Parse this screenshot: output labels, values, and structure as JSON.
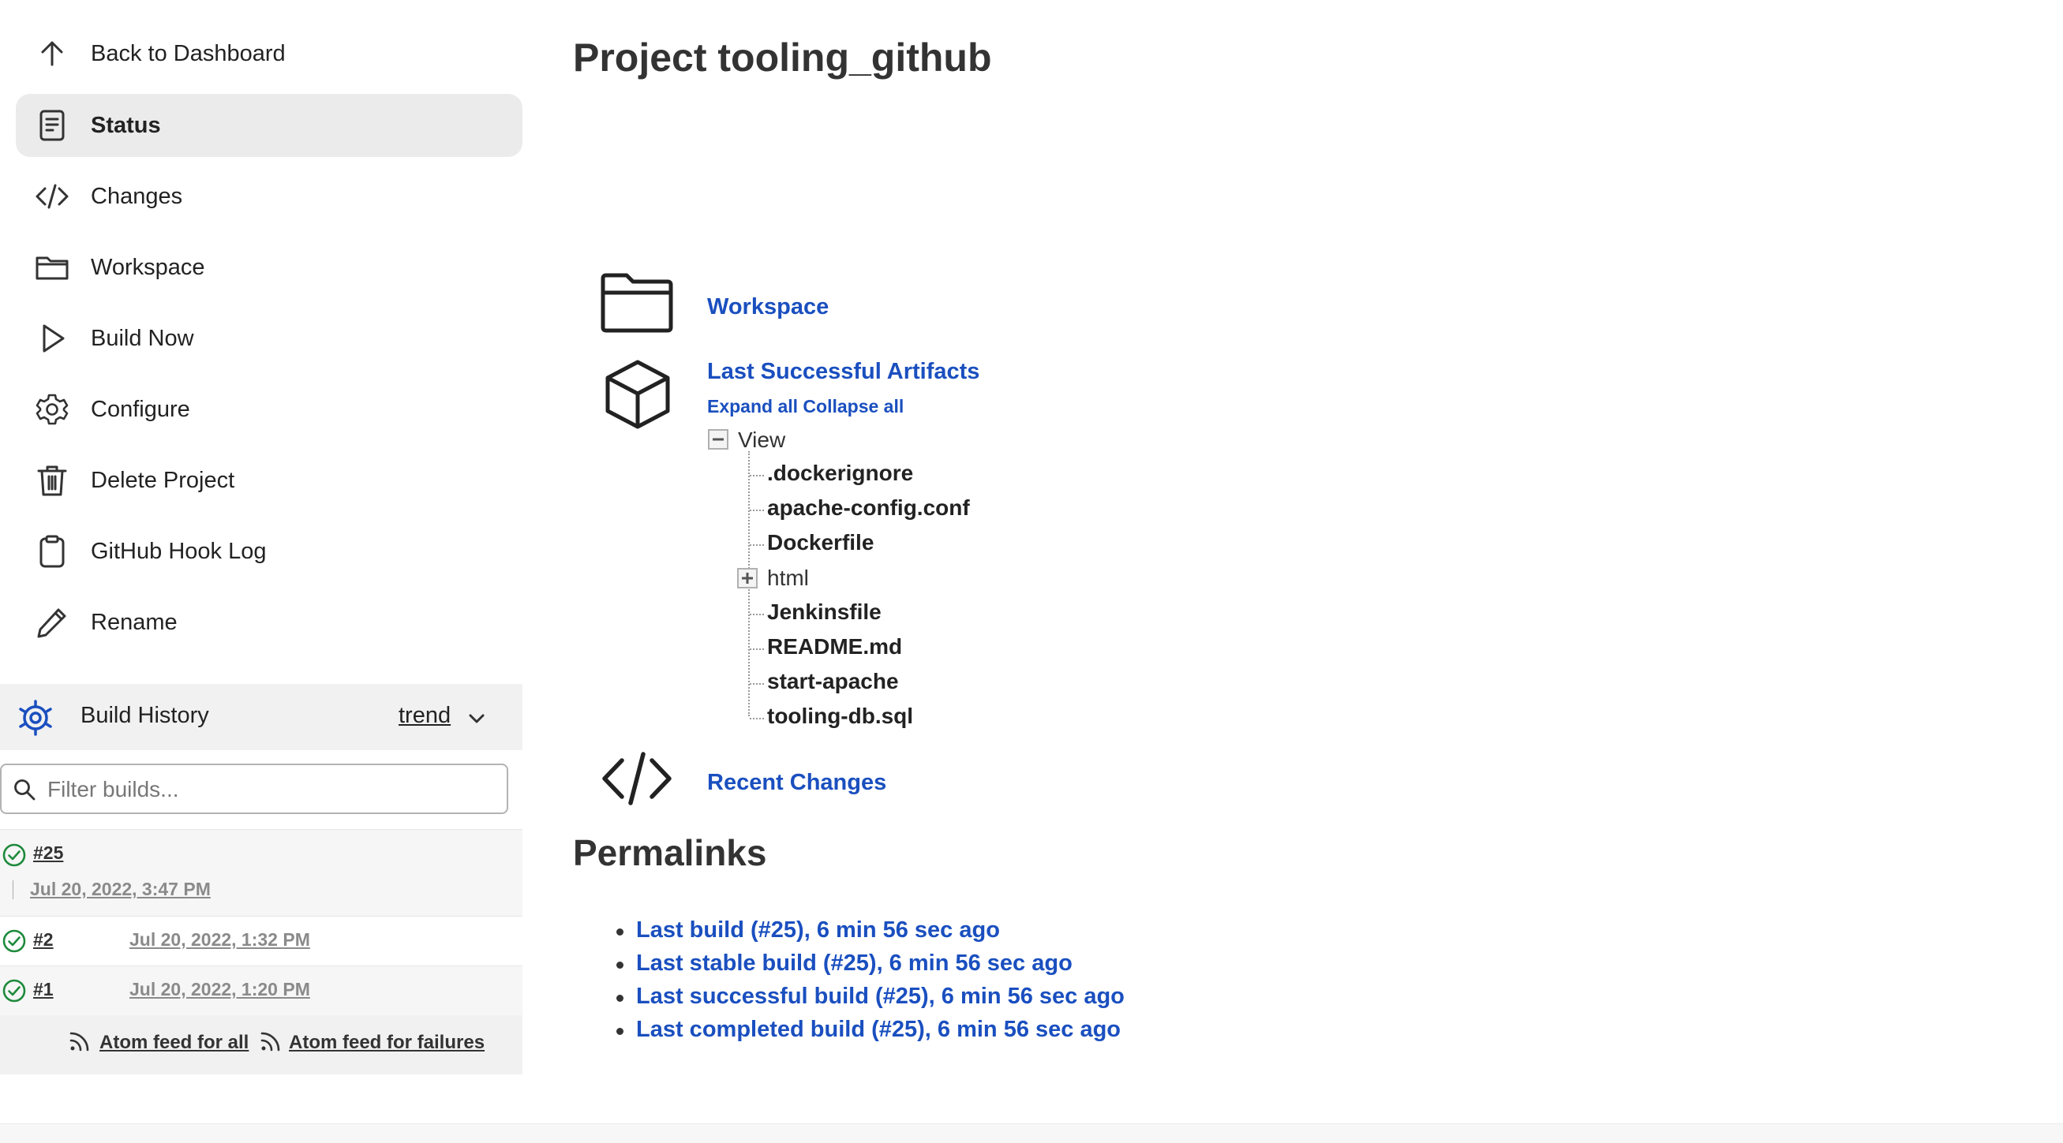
{
  "sidebar": {
    "items": [
      {
        "label": "Back to Dashboard",
        "icon": "arrow-up-icon"
      },
      {
        "label": "Status",
        "icon": "document-icon",
        "active": true
      },
      {
        "label": "Changes",
        "icon": "code-icon"
      },
      {
        "label": "Workspace",
        "icon": "folder-icon"
      },
      {
        "label": "Build Now",
        "icon": "play-icon"
      },
      {
        "label": "Configure",
        "icon": "gear-icon"
      },
      {
        "label": "Delete Project",
        "icon": "trash-icon"
      },
      {
        "label": "GitHub Hook Log",
        "icon": "clipboard-icon"
      },
      {
        "label": "Rename",
        "icon": "pencil-icon"
      }
    ]
  },
  "build_history": {
    "title": "Build History",
    "trend_label": "trend",
    "filter_placeholder": "Filter builds...",
    "builds": [
      {
        "number": "#25",
        "date": "Jul 20, 2022, 3:47 PM",
        "status": "success"
      },
      {
        "number": "#2",
        "date": "Jul 20, 2022, 1:32 PM",
        "status": "success"
      },
      {
        "number": "#1",
        "date": "Jul 20, 2022, 1:20 PM",
        "status": "success"
      }
    ],
    "feed_all": "Atom feed for all",
    "feed_failures": "Atom feed for failures"
  },
  "main": {
    "title": "Project tooling_github",
    "workspace_link": "Workspace",
    "artifacts": {
      "title": "Last Successful Artifacts",
      "expand_collapse": "Expand all Collapse all",
      "root_label": "View",
      "files_before": [
        ".dockerignore",
        "apache-config.conf",
        "Dockerfile"
      ],
      "folder": "html",
      "files_after": [
        "Jenkinsfile",
        "README.md",
        "start-apache",
        "tooling-db.sql"
      ]
    },
    "recent_changes": "Recent Changes"
  },
  "permalinks": {
    "title": "Permalinks",
    "items": [
      "Last build (#25), 6 min 56 sec ago",
      "Last stable build (#25), 6 min 56 sec ago",
      "Last successful build (#25), 6 min 56 sec ago",
      "Last completed build (#25), 6 min 56 sec ago"
    ]
  },
  "colors": {
    "link": "#1a4fbf",
    "success": "#1e8a3c",
    "active_bg": "#ebebeb"
  }
}
